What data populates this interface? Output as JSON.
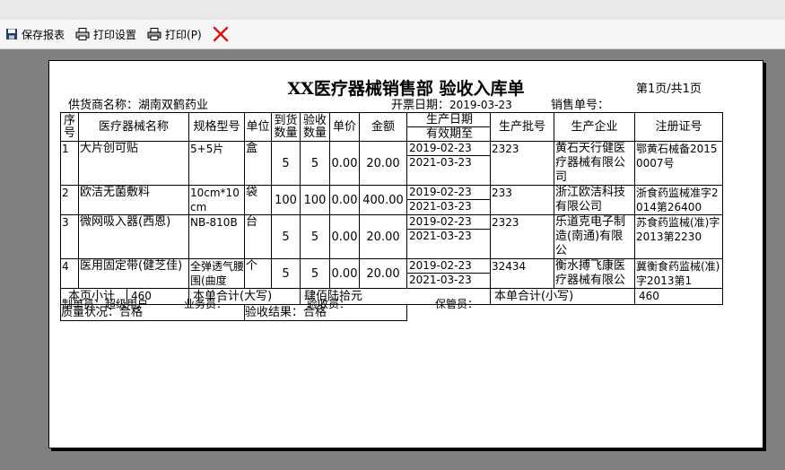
{
  "toolbar": {
    "save_report": "保存报表",
    "print_settings": "打印设置",
    "print": "打印(P)"
  },
  "report": {
    "title": "XX医疗器械销售部  验收入库单",
    "page_info": "第1页/共1页",
    "supplier_label": "供货商名称：",
    "supplier": "湖南双鹤药业",
    "invoice_date_label": "开票日期：",
    "invoice_date": "2019-03-23",
    "sales_no_label": "销售单号：",
    "sales_no": ""
  },
  "table": {
    "headers": {
      "seq": "序号",
      "name": "医疗器械名称",
      "spec": "规格型号",
      "unit": "单位",
      "arrived": "到货数量",
      "accepted": "验收数量",
      "price": "单价",
      "amount": "金额",
      "prod_date": "生产日期",
      "expiry": "有效期至",
      "batch": "生产批号",
      "manufacturer": "生产企业",
      "reg_no": "注册证号"
    },
    "rows": [
      {
        "seq": "1",
        "name": "大片创可贴",
        "spec": "5+5片",
        "unit": "盒",
        "arrived": "5",
        "accepted": "5",
        "price": "0.00",
        "amount": "20.00",
        "prod_date": "2019-02-23",
        "expiry": "2021-03-23",
        "batch": "2323",
        "manufacturer": "黄石天行健医疗器械有限公司",
        "reg_no": "鄂黄石械备20150007号"
      },
      {
        "seq": "2",
        "name": "欧洁无菌敷料",
        "spec": "10cm*10cm",
        "unit": "袋",
        "arrived": "100",
        "accepted": "100",
        "price": "0.00",
        "amount": "400.00",
        "prod_date": "2019-02-23",
        "expiry": "2021-03-23",
        "batch": "233",
        "manufacturer": "浙江欧洁科技有限公司",
        "reg_no": "浙食药监械准字2014第26400"
      },
      {
        "seq": "3",
        "name": "微网吸入器(西恩)",
        "spec": "NB-810B",
        "unit": "台",
        "arrived": "5",
        "accepted": "5",
        "price": "0.00",
        "amount": "20.00",
        "prod_date": "2019-02-23",
        "expiry": "2021-03-23",
        "batch": "2323",
        "manufacturer": "乐道克电子制造(南通)有限公",
        "reg_no": "苏食药监械(准)字2013第2230"
      },
      {
        "seq": "4",
        "name": "医用固定带(健芝佳)",
        "spec": "全弹透气腰围(曲度",
        "unit": "个",
        "arrived": "5",
        "accepted": "5",
        "price": "0.00",
        "amount": "20.00",
        "prod_date": "2019-02-23",
        "expiry": "2021-03-23",
        "batch": "32434",
        "manufacturer": "衡水搏飞康医疗器械有限公",
        "reg_no": "冀衡食药监械(准)字2013第1"
      }
    ],
    "page_subtotal_label": "本页小计",
    "page_subtotal": "460",
    "total_upper_label": "本单合计(大写)",
    "total_upper": "肆佰陆拾元",
    "total_lower_label": "本单合计(小写)",
    "total_lower": "460",
    "quality_label": "质量状况：合格",
    "acceptance_label": "验收结果：合格"
  },
  "signatures": {
    "maker": "制单员：超级用户",
    "salesman": "业务员：",
    "inspector": "验收员：",
    "keeper": "保管员："
  }
}
